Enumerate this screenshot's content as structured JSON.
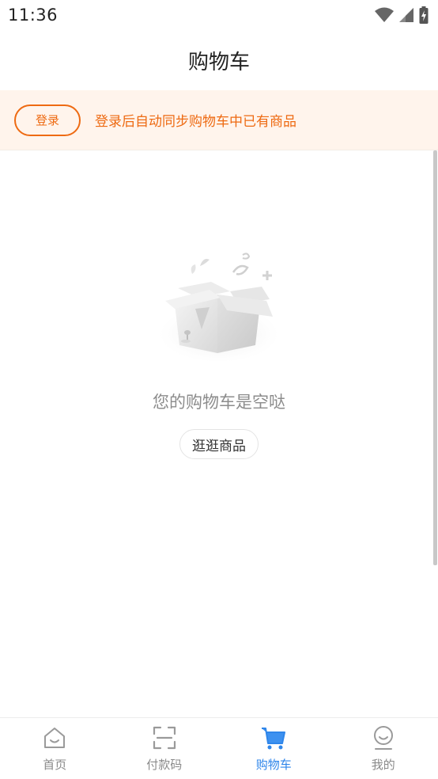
{
  "status_bar": {
    "time": "11:36",
    "icons": [
      "wifi-icon",
      "signal-icon",
      "battery-icon"
    ]
  },
  "header": {
    "title": "购物车"
  },
  "login_banner": {
    "button_label": "登录",
    "tip": "登录后自动同步购物车中已有商品",
    "accent_color": "#ee6a12",
    "background_color": "#fff4ec"
  },
  "empty_state": {
    "icon": "empty-box-icon",
    "message": "您的购物车是空哒",
    "button_label": "逛逛商品"
  },
  "bottom_nav": {
    "active_color": "#2f86ea",
    "items": [
      {
        "label": "首页",
        "icon": "home-icon"
      },
      {
        "label": "付款码",
        "icon": "scan-icon"
      },
      {
        "label": "购物车",
        "icon": "cart-icon",
        "active": true
      },
      {
        "label": "我的",
        "icon": "user-icon"
      }
    ]
  }
}
